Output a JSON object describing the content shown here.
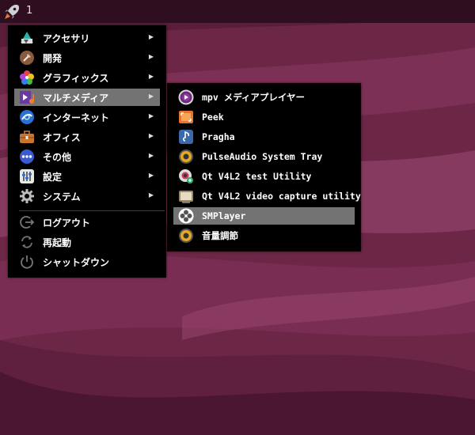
{
  "taskbar": {
    "launcher_icon": "rocket-icon",
    "workspace": "1"
  },
  "main_menu": {
    "items": [
      {
        "label": "アクセサリ",
        "icon": "accessories-icon",
        "submenu": true
      },
      {
        "label": "開発",
        "icon": "development-icon",
        "submenu": true
      },
      {
        "label": "グラフィックス",
        "icon": "graphics-icon",
        "submenu": true
      },
      {
        "label": "マルチメディア",
        "icon": "multimedia-icon",
        "submenu": true,
        "selected": true
      },
      {
        "label": "インターネット",
        "icon": "internet-icon",
        "submenu": true
      },
      {
        "label": "オフィス",
        "icon": "office-icon",
        "submenu": true
      },
      {
        "label": "その他",
        "icon": "other-icon",
        "submenu": true
      },
      {
        "label": "設定",
        "icon": "settings-icon",
        "submenu": true
      },
      {
        "label": "システム",
        "icon": "system-icon",
        "submenu": true
      },
      {
        "label": "ログアウト",
        "icon": "logout-icon",
        "submenu": false
      },
      {
        "label": "再起動",
        "icon": "reboot-icon",
        "submenu": false
      },
      {
        "label": "シャットダウン",
        "icon": "shutdown-icon",
        "submenu": false
      }
    ],
    "arrow": "▶"
  },
  "sub_menu": {
    "items": [
      {
        "label": "mpv メディアプレイヤー",
        "icon": "mpv-icon"
      },
      {
        "label": "Peek",
        "icon": "peek-icon"
      },
      {
        "label": "Pragha",
        "icon": "pragha-icon"
      },
      {
        "label": "PulseAudio System Tray",
        "icon": "pulseaudio-icon"
      },
      {
        "label": "Qt V4L2 test Utility",
        "icon": "qv4l2-icon"
      },
      {
        "label": "Qt V4L2 video capture utility",
        "icon": "qvidcap-icon"
      },
      {
        "label": "SMPlayer",
        "icon": "smplayer-icon",
        "selected": true
      },
      {
        "label": "音量調節",
        "icon": "volume-control-icon"
      }
    ]
  },
  "colors": {
    "selection": "#737373",
    "menu_bg": "#000000",
    "taskbar": "#2f0e20",
    "wallpaper": "#6e2748"
  }
}
